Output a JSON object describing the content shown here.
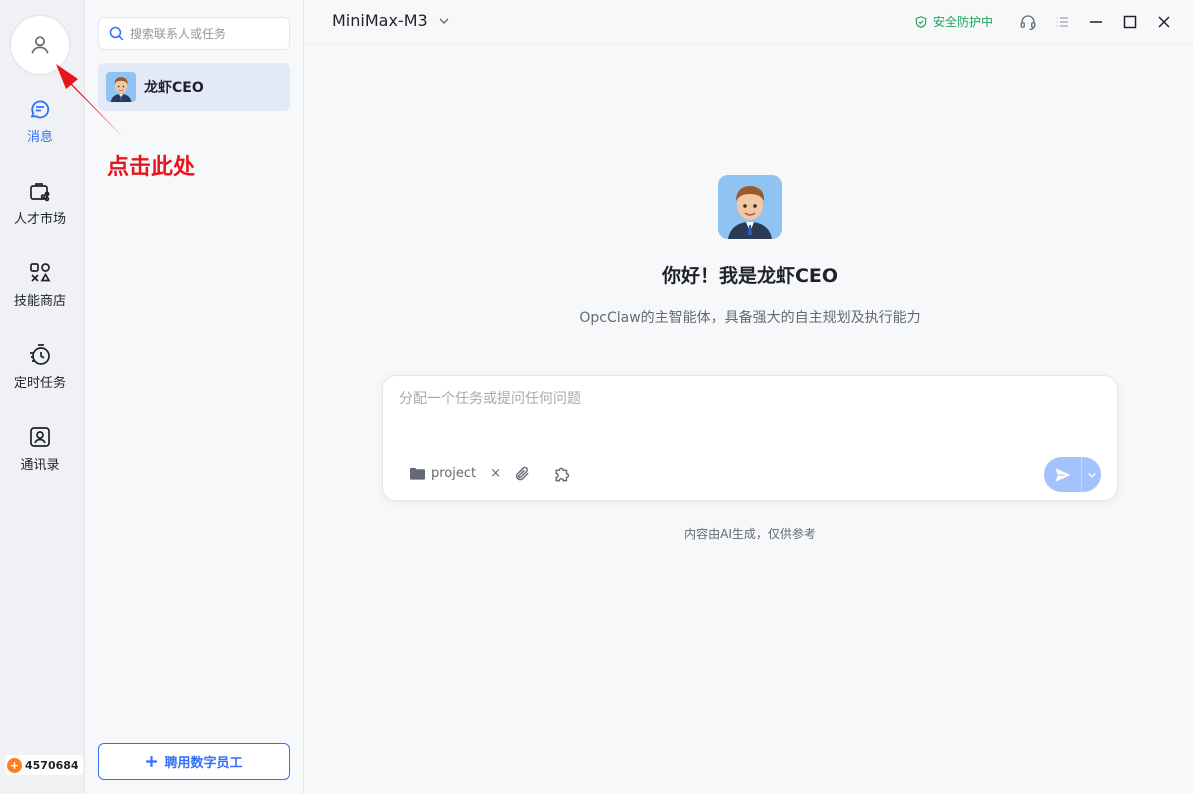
{
  "sidebar": {
    "nav": [
      {
        "label": "消息",
        "icon": "chat-bubble-icon",
        "active": true
      },
      {
        "label": "人才市场",
        "icon": "briefcase-share-icon",
        "active": false
      },
      {
        "label": "技能商店",
        "icon": "shapes-icon",
        "active": false
      },
      {
        "label": "定时任务",
        "icon": "timer-icon",
        "active": false
      },
      {
        "label": "通讯录",
        "icon": "contact-card-icon",
        "active": false
      }
    ],
    "points": "4570684"
  },
  "contacts": {
    "search_placeholder": "搜索联系人或任务",
    "items": [
      {
        "name": "龙虾CEO"
      }
    ],
    "hire_button": "聘用数字员工"
  },
  "topbar": {
    "model": "MiniMax-M3",
    "security": "安全防护中"
  },
  "chat": {
    "greeting": "你好！我是龙虾CEO",
    "subtitle": "OpcClaw的主智能体，具备强大的自主规划及执行能力",
    "input_placeholder": "分配一个任务或提问任何问题",
    "project_chip": "project",
    "chip_close": "×",
    "disclaimer": "内容由AI生成，仅供参考"
  },
  "annotation": {
    "text": "点击此处"
  },
  "colors": {
    "accent": "#3370ff",
    "annotation": "#e8141c",
    "safe": "#20a35a",
    "send": "#a3c2fb"
  }
}
